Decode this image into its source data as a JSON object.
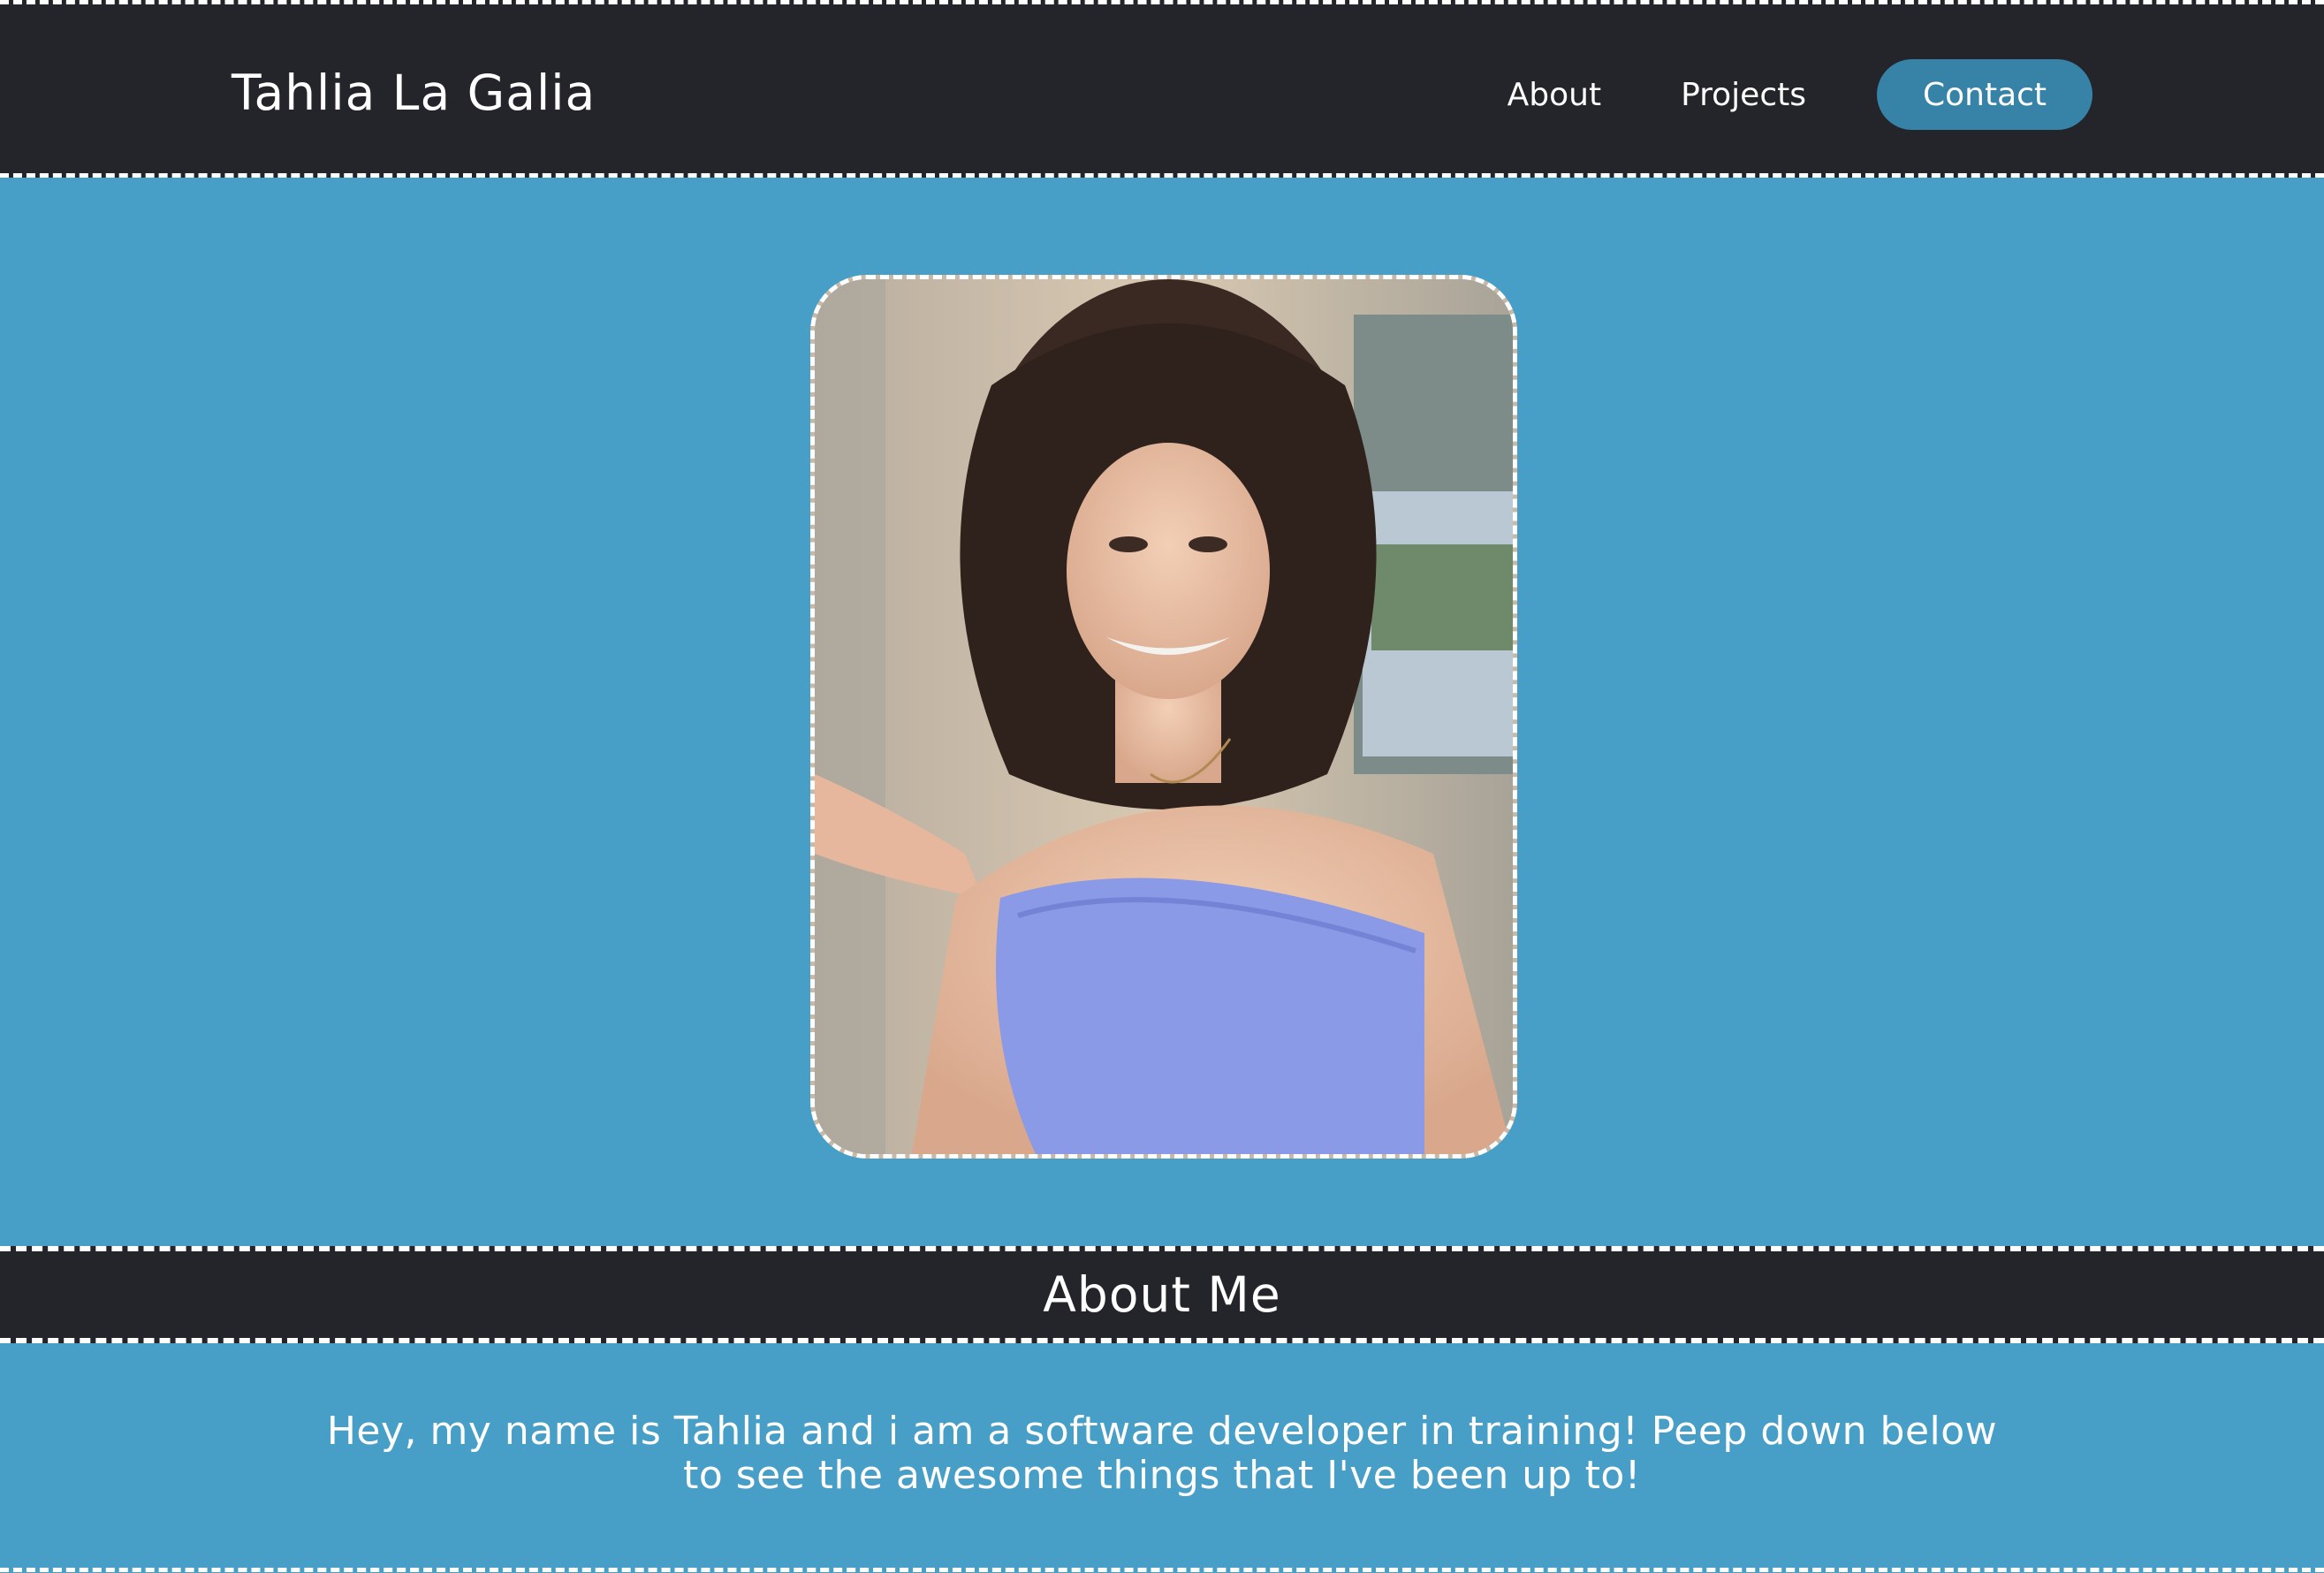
{
  "site": {
    "brand": "Tahlia La Galia"
  },
  "nav": {
    "about": "About",
    "projects": "Projects",
    "contact": "Contact"
  },
  "about_section": {
    "title": "About Me",
    "line1": "Hey, my name is Tahlia and i am a software developer in training! Peep down below",
    "line2": "to see the awesome things that I've been up to!"
  },
  "colors": {
    "header_bg": "#24252b",
    "page_bg": "#479fc7",
    "contact_button": "#3783a8",
    "text": "#ffffff"
  }
}
